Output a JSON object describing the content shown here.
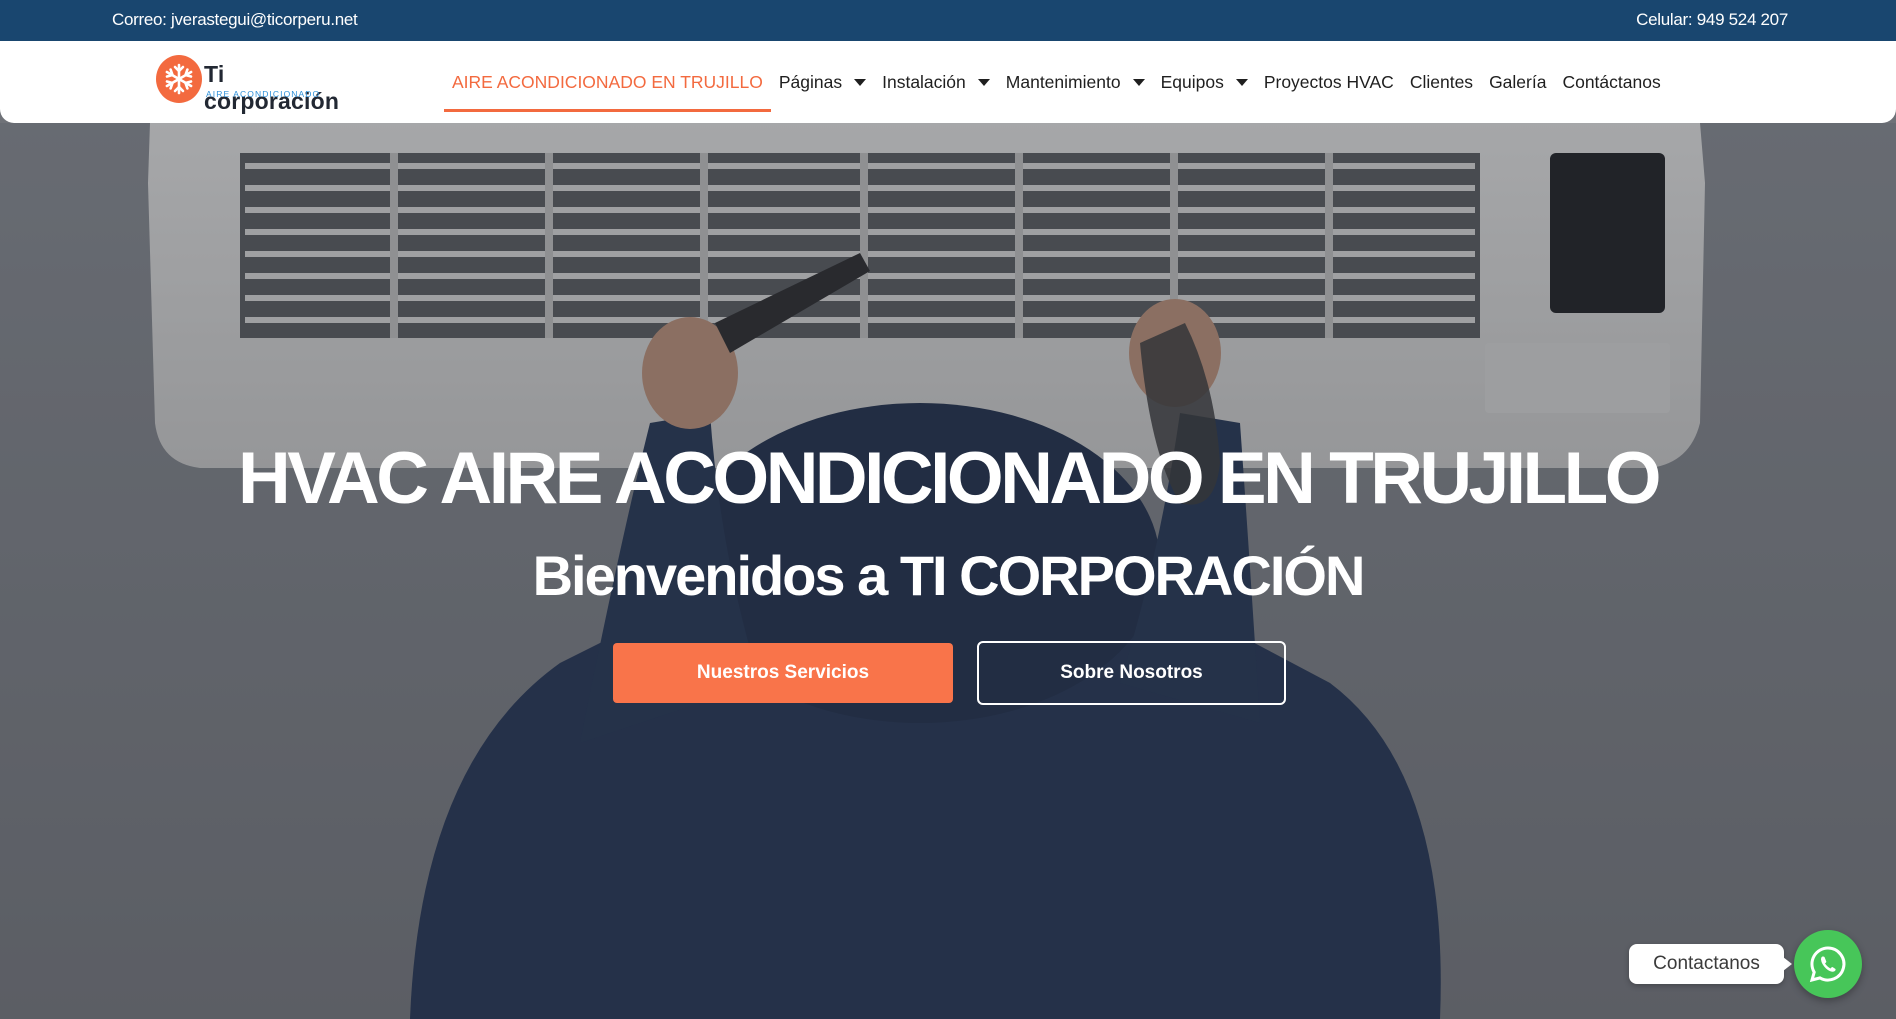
{
  "topbar": {
    "email": "Correo: jverastegui@ticorperu.net",
    "phone": "Celular: 949 524 207"
  },
  "logo": {
    "name": "Ti corporación",
    "tagline": "AIRE ACONDICIONADO",
    "icon": "snowflake-icon"
  },
  "nav": {
    "items": [
      {
        "label": "AIRE ACONDICIONADO EN TRUJILLO",
        "active": true,
        "dropdown": false
      },
      {
        "label": "Páginas",
        "active": false,
        "dropdown": true
      },
      {
        "label": "Instalación",
        "active": false,
        "dropdown": true
      },
      {
        "label": "Mantenimiento",
        "active": false,
        "dropdown": true
      },
      {
        "label": "Equipos",
        "active": false,
        "dropdown": true
      },
      {
        "label": "Proyectos HVAC",
        "active": false,
        "dropdown": false
      },
      {
        "label": "Clientes",
        "active": false,
        "dropdown": false
      },
      {
        "label": "Galería",
        "active": false,
        "dropdown": false
      },
      {
        "label": "Contáctanos",
        "active": false,
        "dropdown": false
      }
    ]
  },
  "hero": {
    "title": "HVAC AIRE ACONDICIONADO EN TRUJILLO",
    "subtitle": "Bienvenidos a TI CORPORACIÓN",
    "primary_button": "Nuestros Servicios",
    "secondary_button": "Sobre Nosotros"
  },
  "whatsapp": {
    "label": "Contactanos",
    "icon": "whatsapp-icon"
  },
  "colors": {
    "topbar": "#19466f",
    "accent": "#f36a3f",
    "button_primary": "#f9744a",
    "whatsapp": "#47c659"
  }
}
